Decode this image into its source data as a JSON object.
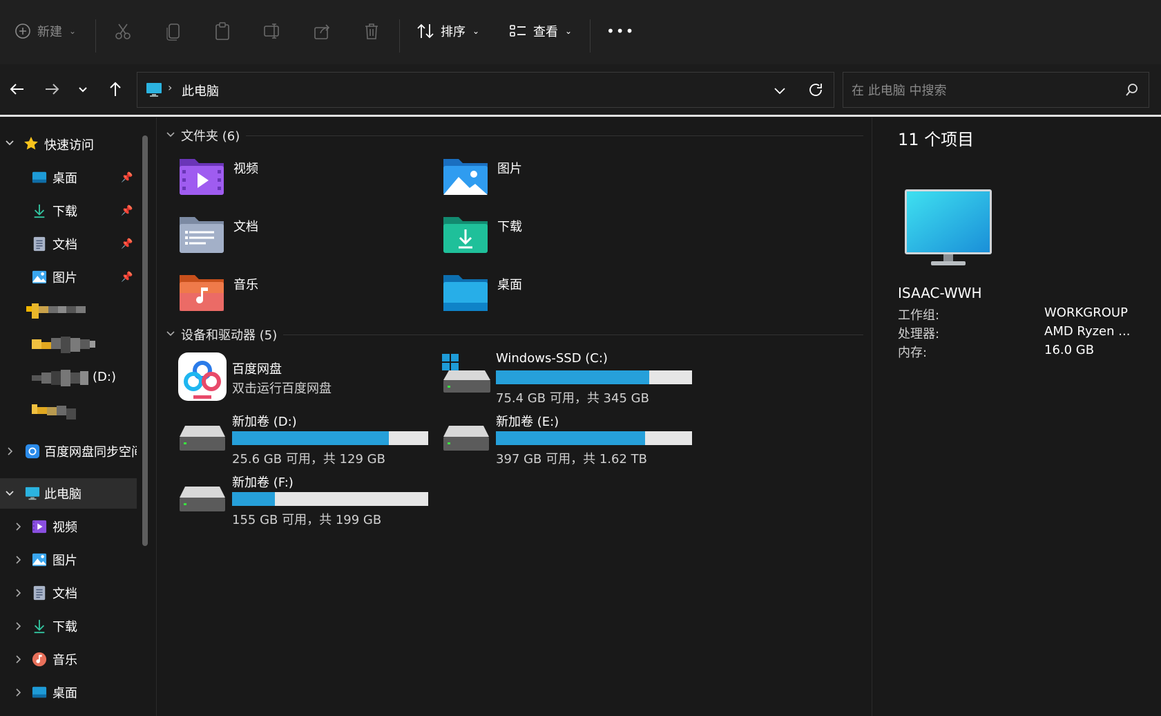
{
  "toolbar": {
    "new_label": "新建",
    "sort_label": "排序",
    "view_label": "查看",
    "more_label": "•••"
  },
  "address": {
    "breadcrumb": "此电脑",
    "search_placeholder": "在 此电脑 中搜索"
  },
  "sidebar": {
    "quick_access": "快速访问",
    "items": [
      {
        "label": "桌面",
        "pinned": true
      },
      {
        "label": "下载",
        "pinned": true
      },
      {
        "label": "文档",
        "pinned": true
      },
      {
        "label": "图片",
        "pinned": true
      },
      {
        "label": ""
      },
      {
        "label": ""
      },
      {
        "label": "(D:)"
      },
      {
        "label": ""
      }
    ],
    "baidu_sync": "百度网盘同步空间",
    "this_pc": "此电脑",
    "pc_children": [
      "视频",
      "图片",
      "文档",
      "下载",
      "音乐",
      "桌面"
    ]
  },
  "content": {
    "folders_header": "文件夹 (6)",
    "folders": [
      "视频",
      "图片",
      "文档",
      "下载",
      "音乐",
      "桌面"
    ],
    "drives_header": "设备和驱动器 (5)",
    "baidu": {
      "name": "百度网盘",
      "sub": "双击运行百度网盘"
    },
    "drives": [
      {
        "name": "Windows-SSD (C:)",
        "sub": "75.4 GB 可用，共 345 GB",
        "used_fraction": 0.78
      },
      {
        "name": "新加卷 (D:)",
        "sub": "25.6 GB 可用，共 129 GB",
        "used_fraction": 0.8
      },
      {
        "name": "新加卷 (E:)",
        "sub": "397 GB 可用，共 1.62 TB",
        "used_fraction": 0.76
      },
      {
        "name": "新加卷 (F:)",
        "sub": "155 GB 可用，共 199 GB",
        "used_fraction": 0.22
      }
    ]
  },
  "details": {
    "count": "11 个项目",
    "computer_name": "ISAAC-WWH",
    "workgroup_label": "工作组:",
    "workgroup_value": "WORKGROUP",
    "cpu_label": "处理器:",
    "cpu_value": "AMD Ryzen ...",
    "ram_label": "内存:",
    "ram_value": "16.0 GB"
  },
  "colors": {
    "accent": "#26a0da",
    "background": "#191919",
    "toolbar": "#202020"
  }
}
